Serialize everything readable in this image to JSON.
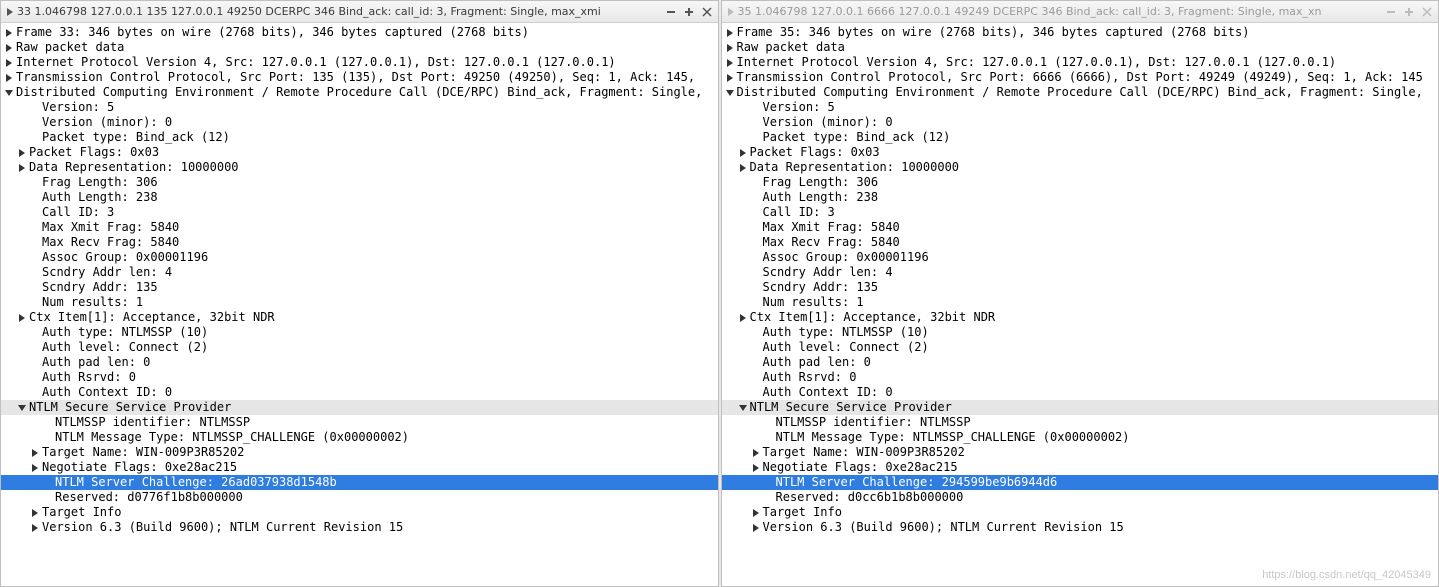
{
  "panes": [
    {
      "active": true,
      "title": "33 1.046798 127.0.0.1 135 127.0.0.1 49250 DCERPC 346 Bind_ack: call_id: 3, Fragment: Single, max_xmi",
      "rows": [
        {
          "indent": 0,
          "tw": "right",
          "text": "Frame 33: 346 bytes on wire (2768 bits), 346 bytes captured (2768 bits)"
        },
        {
          "indent": 0,
          "tw": "right",
          "text": "Raw packet data"
        },
        {
          "indent": 0,
          "tw": "right",
          "text": "Internet Protocol Version 4, Src: 127.0.0.1 (127.0.0.1), Dst: 127.0.0.1 (127.0.0.1)"
        },
        {
          "indent": 0,
          "tw": "right",
          "text": "Transmission Control Protocol, Src Port: 135 (135), Dst Port: 49250 (49250), Seq: 1, Ack: 145, "
        },
        {
          "indent": 0,
          "tw": "down",
          "text": "Distributed Computing Environment / Remote Procedure Call (DCE/RPC) Bind_ack, Fragment: Single,"
        },
        {
          "indent": 2,
          "tw": "none",
          "text": "Version: 5"
        },
        {
          "indent": 2,
          "tw": "none",
          "text": "Version (minor): 0"
        },
        {
          "indent": 2,
          "tw": "none",
          "text": "Packet type: Bind_ack (12)"
        },
        {
          "indent": 1,
          "tw": "right",
          "text": "Packet Flags: 0x03"
        },
        {
          "indent": 1,
          "tw": "right",
          "text": "Data Representation: 10000000"
        },
        {
          "indent": 2,
          "tw": "none",
          "text": "Frag Length: 306"
        },
        {
          "indent": 2,
          "tw": "none",
          "text": "Auth Length: 238"
        },
        {
          "indent": 2,
          "tw": "none",
          "text": "Call ID: 3"
        },
        {
          "indent": 2,
          "tw": "none",
          "text": "Max Xmit Frag: 5840"
        },
        {
          "indent": 2,
          "tw": "none",
          "text": "Max Recv Frag: 5840"
        },
        {
          "indent": 2,
          "tw": "none",
          "text": "Assoc Group: 0x00001196"
        },
        {
          "indent": 2,
          "tw": "none",
          "text": "Scndry Addr len: 4"
        },
        {
          "indent": 2,
          "tw": "none",
          "text": "Scndry Addr: 135"
        },
        {
          "indent": 2,
          "tw": "none",
          "text": "Num results: 1"
        },
        {
          "indent": 1,
          "tw": "right",
          "text": "Ctx Item[1]: Acceptance, 32bit NDR"
        },
        {
          "indent": 2,
          "tw": "none",
          "text": "Auth type: NTLMSSP (10)"
        },
        {
          "indent": 2,
          "tw": "none",
          "text": "Auth level: Connect (2)"
        },
        {
          "indent": 2,
          "tw": "none",
          "text": "Auth pad len: 0"
        },
        {
          "indent": 2,
          "tw": "none",
          "text": "Auth Rsrvd: 0"
        },
        {
          "indent": 2,
          "tw": "none",
          "text": "Auth Context ID: 0"
        },
        {
          "indent": 1,
          "tw": "down",
          "text": "NTLM Secure Service Provider",
          "cls": "expanded-hdr"
        },
        {
          "indent": 3,
          "tw": "none",
          "text": "NTLMSSP identifier: NTLMSSP"
        },
        {
          "indent": 3,
          "tw": "none",
          "text": "NTLM Message Type: NTLMSSP_CHALLENGE (0x00000002)"
        },
        {
          "indent": 2,
          "tw": "right",
          "text": "Target Name: WIN-009P3R85202"
        },
        {
          "indent": 2,
          "tw": "right",
          "text": "Negotiate Flags: 0xe28ac215"
        },
        {
          "indent": 3,
          "tw": "none",
          "text": "NTLM Server Challenge: 26ad037938d1548b",
          "cls": "selected"
        },
        {
          "indent": 3,
          "tw": "none",
          "text": "Reserved: d0776f1b8b000000"
        },
        {
          "indent": 2,
          "tw": "right",
          "text": "Target Info"
        },
        {
          "indent": 2,
          "tw": "right",
          "text": "Version 6.3 (Build 9600); NTLM Current Revision 15"
        }
      ]
    },
    {
      "active": false,
      "title": "35 1.046798 127.0.0.1 6666 127.0.0.1 49249 DCERPC 346 Bind_ack: call_id: 3, Fragment: Single, max_xn",
      "rows": [
        {
          "indent": 0,
          "tw": "right",
          "text": "Frame 35: 346 bytes on wire (2768 bits), 346 bytes captured (2768 bits)"
        },
        {
          "indent": 0,
          "tw": "right",
          "text": "Raw packet data"
        },
        {
          "indent": 0,
          "tw": "right",
          "text": "Internet Protocol Version 4, Src: 127.0.0.1 (127.0.0.1), Dst: 127.0.0.1 (127.0.0.1)"
        },
        {
          "indent": 0,
          "tw": "right",
          "text": "Transmission Control Protocol, Src Port: 6666 (6666), Dst Port: 49249 (49249), Seq: 1, Ack: 145"
        },
        {
          "indent": 0,
          "tw": "down",
          "text": "Distributed Computing Environment / Remote Procedure Call (DCE/RPC) Bind_ack, Fragment: Single,"
        },
        {
          "indent": 2,
          "tw": "none",
          "text": "Version: 5"
        },
        {
          "indent": 2,
          "tw": "none",
          "text": "Version (minor): 0"
        },
        {
          "indent": 2,
          "tw": "none",
          "text": "Packet type: Bind_ack (12)"
        },
        {
          "indent": 1,
          "tw": "right",
          "text": "Packet Flags: 0x03"
        },
        {
          "indent": 1,
          "tw": "right",
          "text": "Data Representation: 10000000"
        },
        {
          "indent": 2,
          "tw": "none",
          "text": "Frag Length: 306"
        },
        {
          "indent": 2,
          "tw": "none",
          "text": "Auth Length: 238"
        },
        {
          "indent": 2,
          "tw": "none",
          "text": "Call ID: 3"
        },
        {
          "indent": 2,
          "tw": "none",
          "text": "Max Xmit Frag: 5840"
        },
        {
          "indent": 2,
          "tw": "none",
          "text": "Max Recv Frag: 5840"
        },
        {
          "indent": 2,
          "tw": "none",
          "text": "Assoc Group: 0x00001196"
        },
        {
          "indent": 2,
          "tw": "none",
          "text": "Scndry Addr len: 4"
        },
        {
          "indent": 2,
          "tw": "none",
          "text": "Scndry Addr: 135"
        },
        {
          "indent": 2,
          "tw": "none",
          "text": "Num results: 1"
        },
        {
          "indent": 1,
          "tw": "right",
          "text": "Ctx Item[1]: Acceptance, 32bit NDR"
        },
        {
          "indent": 2,
          "tw": "none",
          "text": "Auth type: NTLMSSP (10)"
        },
        {
          "indent": 2,
          "tw": "none",
          "text": "Auth level: Connect (2)"
        },
        {
          "indent": 2,
          "tw": "none",
          "text": "Auth pad len: 0"
        },
        {
          "indent": 2,
          "tw": "none",
          "text": "Auth Rsrvd: 0"
        },
        {
          "indent": 2,
          "tw": "none",
          "text": "Auth Context ID: 0"
        },
        {
          "indent": 1,
          "tw": "down",
          "text": "NTLM Secure Service Provider",
          "cls": "expanded-hdr"
        },
        {
          "indent": 3,
          "tw": "none",
          "text": "NTLMSSP identifier: NTLMSSP"
        },
        {
          "indent": 3,
          "tw": "none",
          "text": "NTLM Message Type: NTLMSSP_CHALLENGE (0x00000002)"
        },
        {
          "indent": 2,
          "tw": "right",
          "text": "Target Name: WIN-009P3R85202"
        },
        {
          "indent": 2,
          "tw": "right",
          "text": "Negotiate Flags: 0xe28ac215"
        },
        {
          "indent": 3,
          "tw": "none",
          "text": "NTLM Server Challenge: 294599be9b6944d6",
          "cls": "selected"
        },
        {
          "indent": 3,
          "tw": "none",
          "text": "Reserved: d0cc6b1b8b000000"
        },
        {
          "indent": 2,
          "tw": "right",
          "text": "Target Info"
        },
        {
          "indent": 2,
          "tw": "right",
          "text": "Version 6.3 (Build 9600); NTLM Current Revision 15"
        }
      ]
    }
  ],
  "watermark": "https://blog.csdn.net/qq_42045349"
}
